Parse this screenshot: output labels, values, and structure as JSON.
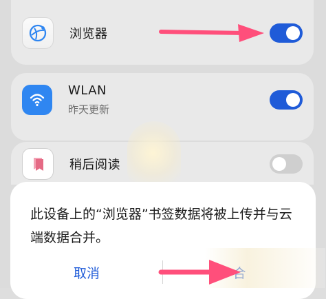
{
  "colors": {
    "accent_blue": "#1f5bd8",
    "arrow_pink": "#ff4f7b",
    "wlan_icon_blue": "#2f86f1"
  },
  "settings": {
    "rows": [
      {
        "title": "浏览器",
        "subtitle": "",
        "icon": "globe-icon",
        "toggle_on": true
      },
      {
        "title": "WLAN",
        "subtitle": "昨天更新",
        "icon": "wifi-icon",
        "toggle_on": true
      },
      {
        "title": "稍后阅读",
        "subtitle": "",
        "icon": "bookmark-icon",
        "toggle_on": false
      }
    ]
  },
  "dialog": {
    "message": "此设备上的“浏览器”书签数据将被上传并与云端数据合并。",
    "cancel_label": "取消",
    "confirm_label": "合"
  }
}
